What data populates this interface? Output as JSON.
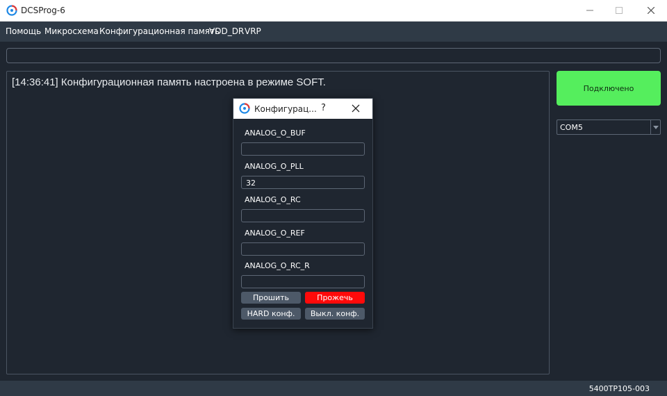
{
  "window": {
    "title": "DCSProg-6"
  },
  "menu": {
    "items": [
      "Помощь",
      "Микросхема",
      "Конфигурационная память",
      "VDD_DR",
      "VRP"
    ]
  },
  "path_input": {
    "value": ""
  },
  "log": {
    "lines": [
      "[14:36:41] Конфигурационная память настроена в режиме SOFT."
    ]
  },
  "connection": {
    "status_label": "Подключено",
    "status_color": "#55ee5d",
    "port": "COM5"
  },
  "statusbar": {
    "chip_id": "5400ТР105-003"
  },
  "dialog": {
    "title": "Конфигурац...",
    "help": "?",
    "fields": [
      {
        "label": "ANALOG_O_BUF",
        "value": ""
      },
      {
        "label": "ANALOG_O_PLL",
        "value": "32"
      },
      {
        "label": "ANALOG_O_RC",
        "value": ""
      },
      {
        "label": "ANALOG_O_REF",
        "value": ""
      },
      {
        "label": "ANALOG_O_RC_R",
        "value": ""
      }
    ],
    "buttons": {
      "read": "Прошить",
      "burn": "Прожечь",
      "burn_color": "#ff0a0a",
      "hard": "HARD конф.",
      "off": "Выкл. конф."
    }
  }
}
